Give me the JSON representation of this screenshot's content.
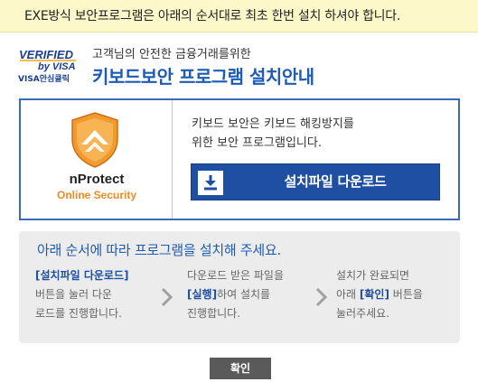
{
  "notice": {
    "text": "EXE방식 보안프로그램은 아래의 순서대로 최초 한번 설치 하셔야 합니다."
  },
  "header": {
    "logo": {
      "line1": "VERIFIED",
      "line2": "by VISA",
      "line3": "VISA안심클릭"
    },
    "subtitle": "고객님의 안전한 금융거래를위한",
    "title": "키보드보안 프로그램 설치안내"
  },
  "product": {
    "brand_name": "nProtect",
    "brand_sub": "Online Security",
    "description_line1": "키보드 보안은 키보드 해킹방지를",
    "description_line2": "위한 보안 프로그램입니다.",
    "download_label": "설치파일 다운로드",
    "download_icon": "download-icon"
  },
  "steps": {
    "title": "아래 순서에 따라 프로그램을 설치해 주세요.",
    "step1": {
      "line1": "[설치파일 다운로드]",
      "line2": "버튼을 눌러 다운",
      "line3": "로드를 진행합니다."
    },
    "step2": {
      "line1": "다운로드 받은 파일을",
      "line2_hl": "[실행]",
      "line2_rest": "하여 설치를",
      "line3": "진행합니다."
    },
    "step3": {
      "line1": "설치가 완료되면",
      "line2_pre": "아래 ",
      "line2_hl": "[확인]",
      "line2_rest": " 버튼을",
      "line3": "눌러주세요."
    }
  },
  "footer": {
    "confirm_label": "확인"
  },
  "colors": {
    "notice_bg": "#fdf8c9",
    "accent_blue": "#1e5bb5",
    "button_blue": "#1e4fa3",
    "brand_orange": "#f08a24",
    "steps_bg": "#ececec",
    "confirm_bg": "#5a5a5a"
  }
}
